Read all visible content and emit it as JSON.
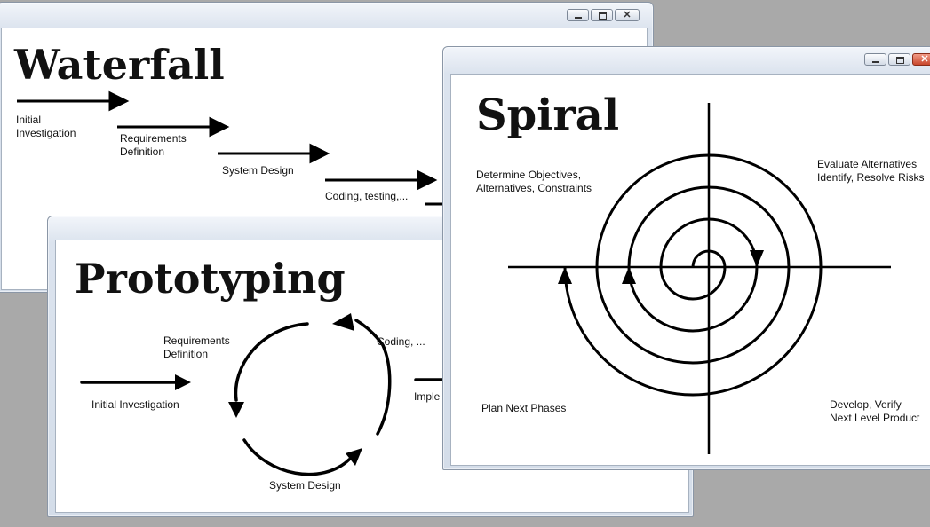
{
  "waterfall": {
    "title": "Waterfall",
    "steps": [
      {
        "line1": "Initial",
        "line2": "Investigation"
      },
      {
        "line1": "Requirements",
        "line2": "Definition"
      },
      {
        "line1": "System Design",
        "line2": ""
      },
      {
        "line1": "Coding, testing,...",
        "line2": ""
      }
    ]
  },
  "prototyping": {
    "title": "Prototyping",
    "labels": {
      "initial": "Initial Investigation",
      "req_line1": "Requirements",
      "req_line2": "Definition",
      "coding": "Coding, ...",
      "design": "System Design",
      "impl": "Imple"
    }
  },
  "spiral": {
    "title": "Spiral",
    "quadrants": {
      "top_left_line1": "Determine Objectives,",
      "top_left_line2": "Alternatives, Constraints",
      "top_right_line1": "Evaluate Alternatives",
      "top_right_line2": "Identify, Resolve Risks",
      "bottom_left": "Plan Next Phases",
      "bottom_right_line1": "Develop, Verify",
      "bottom_right_line2": "Next Level Product"
    }
  },
  "window_controls": {
    "minimize": "minimize-icon",
    "maximize": "maximize-icon",
    "close": "close-icon",
    "close_glyph": "✕"
  }
}
